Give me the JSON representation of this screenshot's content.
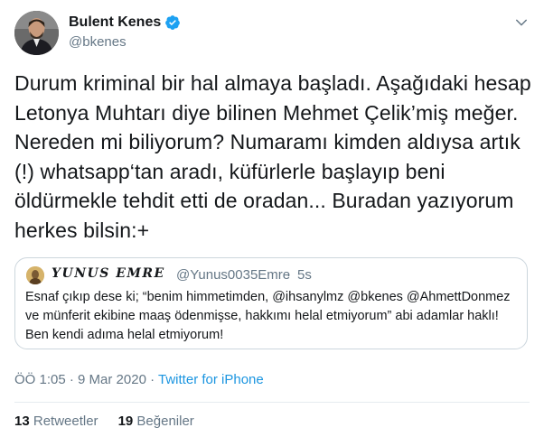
{
  "author": {
    "display_name": "Bulent Kenes",
    "handle": "@bkenes",
    "verified_icon": "verified-badge-icon"
  },
  "tweet": {
    "lines": [
      "Durum kriminal bir hal almaya başladı. Aşağıdaki hesap",
      "Letonya Muhtarı diye bilinen Mehmet Çelik’miş meğer.",
      "Nereden mi biliyorum? Numaramı kimden aldıysa artık",
      "(!) whatsapp‘tan aradı, küfürlerle başlayıp beni",
      "öldürmekle tehdit etti de oradan... Buradan yazıyorum",
      "herkes bilsin:+"
    ]
  },
  "quote": {
    "display_name": "𝒀𝑼𝑵𝑼𝑺 𝑬𝑴𝑹𝑬",
    "handle": "@Yunus0035Emre",
    "separator": "·",
    "time": "5s",
    "lines": [
      "Esnaf çıkıp dese ki; “benim himmetimden, @ihsanylmz @bkenes @AhmettDonmez",
      "ve münferit ekibine maaş ödenmişse, hakkımı helal etmiyorum” abi adamlar haklı!",
      "Ben kendi adıma helal etmiyorum!"
    ]
  },
  "meta": {
    "time": "ÖÖ 1:05",
    "separator": "·",
    "date": "9 Mar 2020",
    "source": "Twitter for iPhone"
  },
  "stats": {
    "retweets_count": "13",
    "retweets_label": "Retweetler",
    "likes_count": "19",
    "likes_label": "Beğeniler"
  },
  "colors": {
    "link": "#1b95e0",
    "secondary_text": "#657786",
    "border": "#ccd6dd"
  }
}
